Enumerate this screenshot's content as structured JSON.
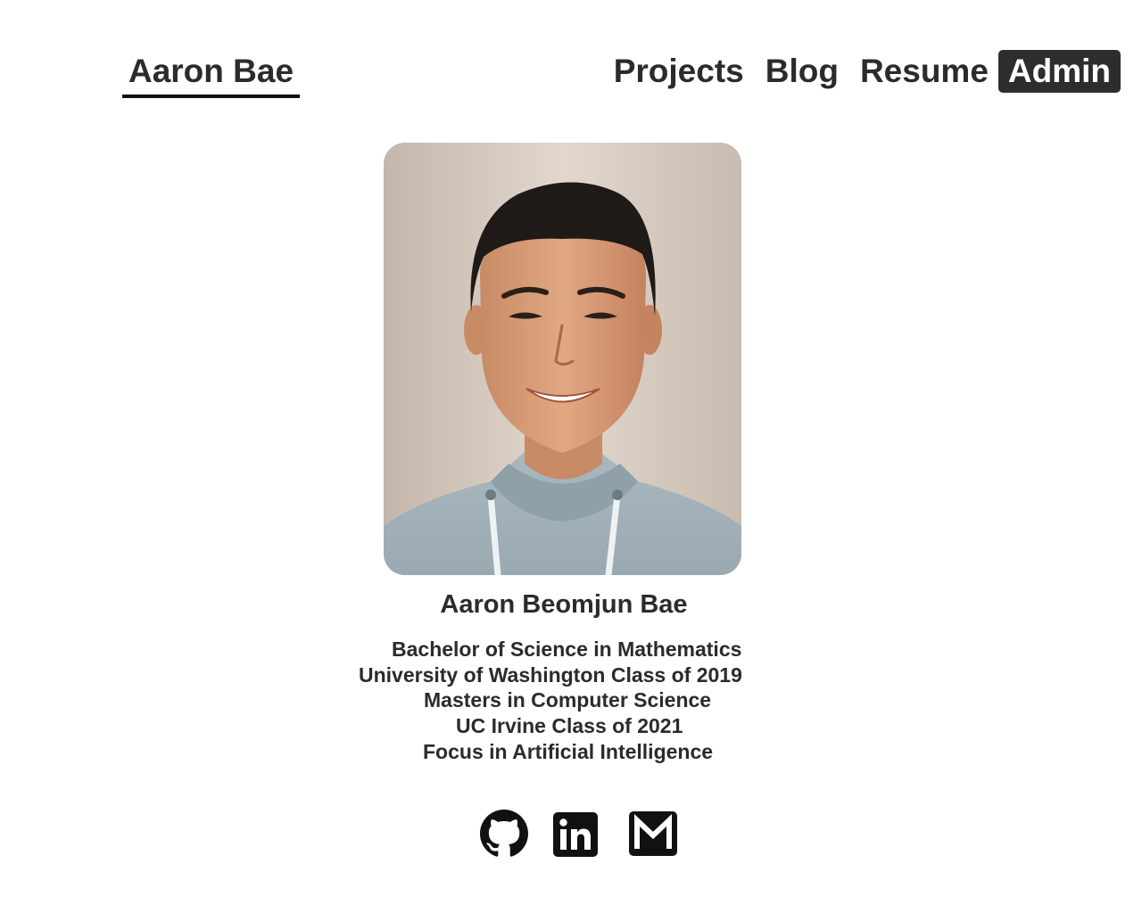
{
  "header": {
    "brand": "Aaron Bae",
    "nav": [
      {
        "label": "Projects",
        "active": false
      },
      {
        "label": "Blog",
        "active": false
      },
      {
        "label": "Resume",
        "active": false
      },
      {
        "label": "Admin",
        "active": true
      }
    ]
  },
  "profile": {
    "photo_icon": "profile-photo",
    "name": "Aaron Beomjun Bae",
    "bio": [
      "Bachelor of Science in Mathematics",
      "University of Washington Class of 2019",
      "Masters in Computer Science",
      "UC Irvine Class of 2021",
      "Focus in Artificial Intelligence"
    ]
  },
  "socials": [
    {
      "icon": "github-icon"
    },
    {
      "icon": "linkedin-icon"
    },
    {
      "icon": "gmail-icon"
    }
  ],
  "colors": {
    "text": "#2b2b2b",
    "active_nav_bg": "#2d2d2d",
    "active_nav_text": "#ffffff",
    "underline": "#111111"
  }
}
